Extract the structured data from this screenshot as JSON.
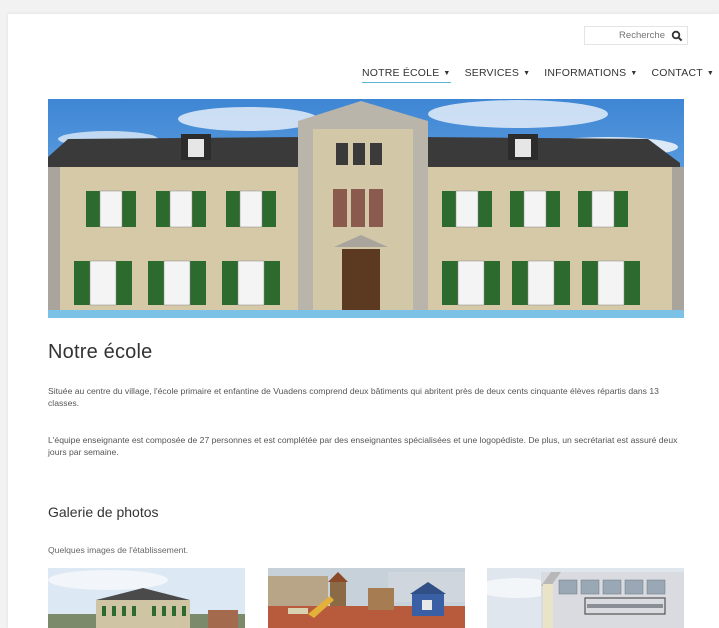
{
  "search": {
    "placeholder": "Recherche",
    "icon": "search-icon"
  },
  "nav": {
    "items": [
      {
        "label": "NOTRE ÉCOLE",
        "arrow": "▼"
      },
      {
        "label": "SERVICES",
        "arrow": "▼"
      },
      {
        "label": "INFORMATIONS",
        "arrow": "▼"
      },
      {
        "label": "CONTACT",
        "arrow": "▼"
      }
    ],
    "active_color": "#5bb5d6"
  },
  "main": {
    "title": "Notre école",
    "paragraphs": [
      "Située au centre du village, l'école primaire et enfantine de Vuadens comprend deux bâtiments qui abritent près de deux cents cinquante élèves répartis dans 13 classes.",
      "L'équipe enseignante est composée de 27 personnes et est complétée par des enseignantes spécialisées et une logopédiste. De plus, un secrétariat est assuré deux jours par semaine."
    ]
  },
  "gallery": {
    "title": "Galerie de photos",
    "subtitle": "Quelques images de l'établissement."
  }
}
